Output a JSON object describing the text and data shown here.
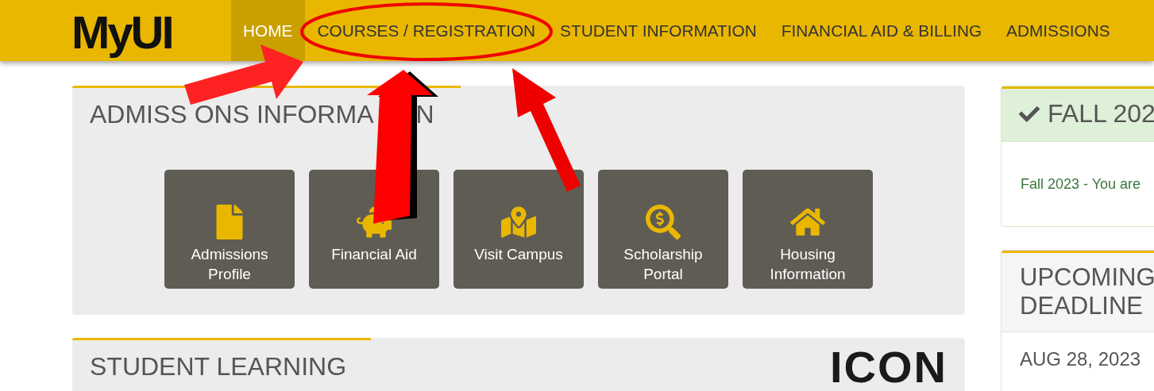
{
  "header": {
    "logo": "MyUI",
    "nav": [
      {
        "label": "HOME",
        "selected": true
      },
      {
        "label": "COURSES / REGISTRATION",
        "selected": false
      },
      {
        "label": "STUDENT INFORMATION",
        "selected": false
      },
      {
        "label": "FINANCIAL AID & BILLING",
        "selected": false
      },
      {
        "label": "ADMISSIONS",
        "selected": false
      }
    ]
  },
  "admissions": {
    "title_parts": [
      "ADMISS",
      "ONS INFORMA",
      "N"
    ],
    "tiles": [
      {
        "label": "Admissions Profile"
      },
      {
        "label": "Financial Aid"
      },
      {
        "label": "Visit Campus"
      },
      {
        "label": "Scholarship Portal"
      },
      {
        "label": "Housing Information"
      }
    ]
  },
  "student_learning": {
    "title": "STUDENT LEARNING",
    "logo": "ICON"
  },
  "term_status": {
    "title": "FALL 202",
    "message": "Fall 2023 - You are"
  },
  "deadlines": {
    "title_lines": [
      "UPCOMING",
      "DEADLINE"
    ],
    "date": "AUG 28, 2023"
  }
}
